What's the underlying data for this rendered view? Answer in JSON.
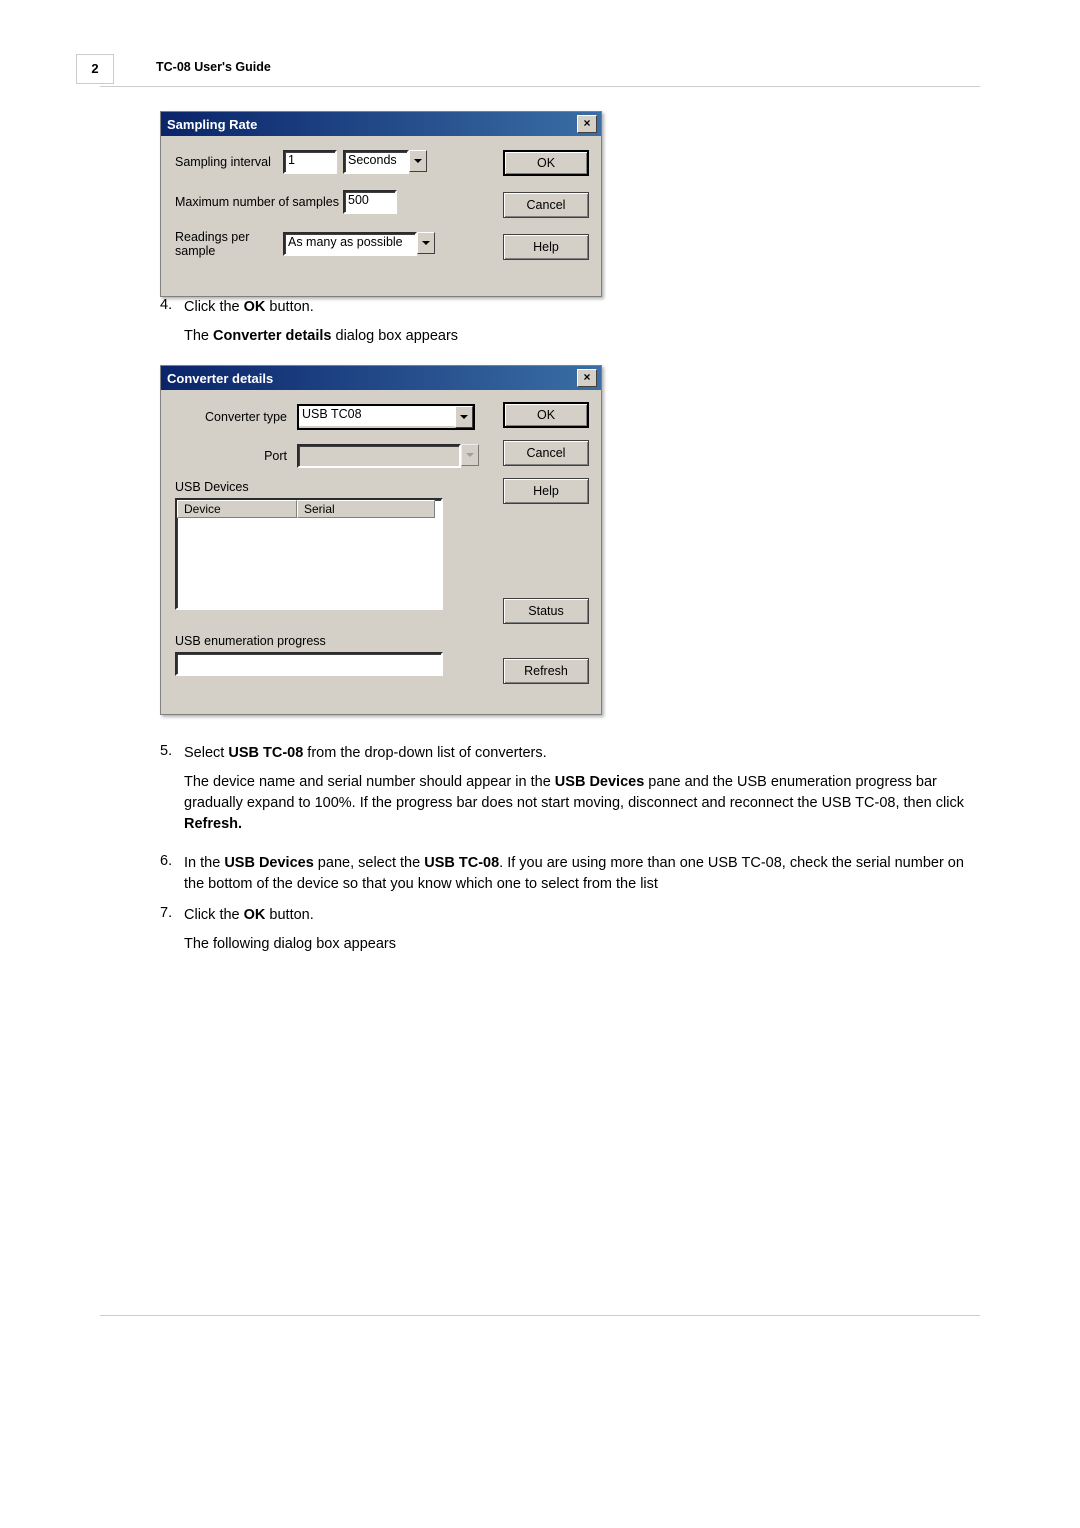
{
  "page": {
    "number": "2",
    "header_title_bold": "TC-08 ",
    "header_title_rest": "User's Guide"
  },
  "dialog1": {
    "title": "Sampling Rate",
    "sampling_interval_label": "Sampling interval",
    "sampling_interval_value": "1",
    "sampling_interval_unit": "Seconds",
    "max_samples_label": "Maximum number of samples",
    "max_samples_value": "500",
    "readings_label_l1": "Readings per",
    "readings_label_l2": "sample",
    "readings_value": "As many as possible",
    "ok": "OK",
    "cancel": "Cancel",
    "help": "Help"
  },
  "step4": {
    "num": "4.",
    "text_pre": "Click the ",
    "text_bold": "OK",
    "text_post": " button.",
    "text2_pre": "The ",
    "text2_bold": "Converter details",
    "text2_post": " dialog box appears"
  },
  "dialog2": {
    "title": "Converter details",
    "converter_type_label": "Converter type",
    "converter_type_value": "USB TC08",
    "port_label": "Port",
    "usb_devices_label": "USB Devices",
    "col_device": "Device",
    "col_serial": "Serial",
    "usb_progress_label": "USB enumeration progress",
    "ok": "OK",
    "cancel": "Cancel",
    "help": "Help",
    "status": "Status",
    "refresh": "Refresh"
  },
  "step5": {
    "num": "5.",
    "text_pre": "Select ",
    "text_bold": "USB TC-08",
    "text_post": " from the drop-down list of converters.",
    "para_a": "The device name and serial number should appear in the ",
    "para_b_bold": "USB Devices",
    "para_c": " pane and the USB enumeration progress bar gradually expand to 100%.  If the progress bar does not start moving, disconnect and reconnect the USB TC-08, then click ",
    "para_d_bold": "Refresh."
  },
  "step6": {
    "num": "6.",
    "a": "In the ",
    "b_bold": "USB Devices",
    "c": " pane, select the ",
    "d_bold": "USB TC-08",
    "e": ".  If you are using more than one USB TC-08, check the serial number on the bottom of the device so that you know which one to select from the list"
  },
  "step7": {
    "num": "7.",
    "text_pre": "Click the ",
    "text_bold": "OK",
    "text_post": " button.",
    "text2": "The following dialog box appears"
  }
}
